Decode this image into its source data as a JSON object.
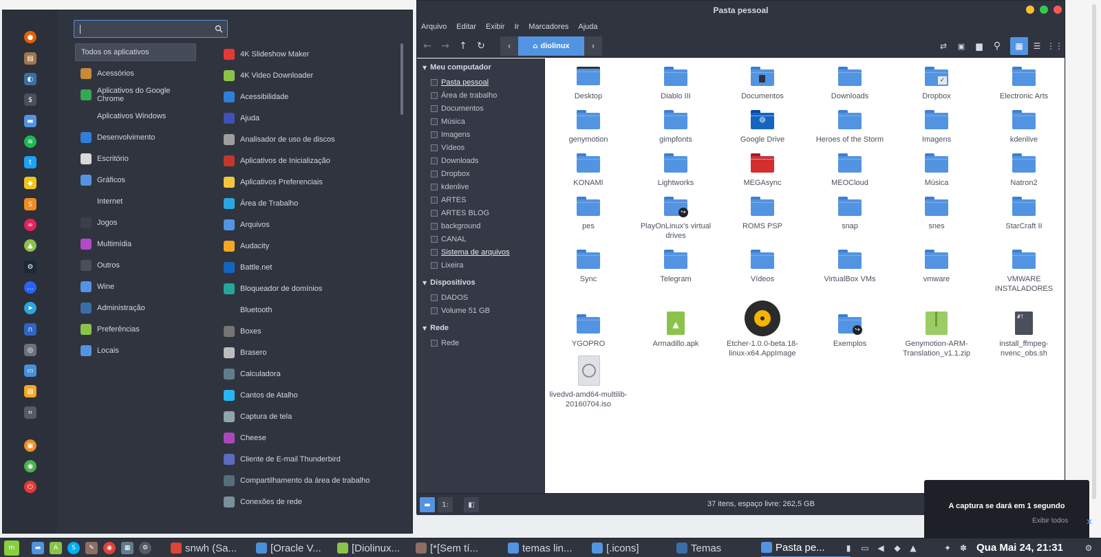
{
  "menu": {
    "search": {
      "value": "",
      "placeholder": ""
    },
    "favorites": [
      {
        "icon": "firefox-icon",
        "color": "#e66000"
      },
      {
        "icon": "archive-icon",
        "color": "#a0774a"
      },
      {
        "icon": "toggle-icon",
        "color": "#3a6ea5"
      },
      {
        "icon": "terminal-icon",
        "color": "#4a4f5a"
      },
      {
        "icon": "folder-icon",
        "color": "#5294e2"
      },
      {
        "icon": "spotify-icon",
        "color": "#1db954"
      },
      {
        "icon": "twitter-icon",
        "color": "#1da1f2"
      },
      {
        "icon": "ideas-icon",
        "color": "#f0c419"
      },
      {
        "icon": "sublime-icon",
        "color": "#f08b22"
      },
      {
        "icon": "flickr-icon",
        "color": "#e0245e"
      },
      {
        "icon": "android-icon",
        "color": "#8bc34a"
      },
      {
        "icon": "steam-icon",
        "color": "#1b2838"
      },
      {
        "icon": "chat-icon",
        "color": "#2962ff"
      },
      {
        "icon": "telegram-icon",
        "color": "#2ca5e0"
      },
      {
        "icon": "audacity-icon",
        "color": "#2e66c4"
      },
      {
        "icon": "gamepad-icon",
        "color": "#6b7280"
      },
      {
        "icon": "monitor-icon",
        "color": "#4a90d9"
      },
      {
        "icon": "photo-icon",
        "color": "#f5a623"
      },
      {
        "icon": "screenshot-icon",
        "color": "#555b66"
      },
      {
        "icon": "lock-icon",
        "color": "#f08b22"
      },
      {
        "icon": "update-icon",
        "color": "#4caf50"
      },
      {
        "icon": "power-icon",
        "color": "#e53935"
      }
    ],
    "categories": [
      {
        "label": "Todos os aplicativos",
        "icon": "all-apps-icon",
        "color": "transparent",
        "selected": true
      },
      {
        "label": "Acessórios",
        "icon": "accessories-icon",
        "color": "#c78a3a"
      },
      {
        "label": "Aplicativos do Google Chrome",
        "icon": "chrome-icon",
        "color": "#34a853"
      },
      {
        "label": "Aplicativos Windows",
        "icon": "windows-apps-icon",
        "color": "transparent"
      },
      {
        "label": "Desenvolvimento",
        "icon": "development-icon",
        "color": "#2f7fd8"
      },
      {
        "label": "Escritório",
        "icon": "office-icon",
        "color": "#d9d9d9"
      },
      {
        "label": "Gráficos",
        "icon": "graphics-icon",
        "color": "#5294e2"
      },
      {
        "label": "Internet",
        "icon": "internet-icon",
        "color": "transparent"
      },
      {
        "label": "Jogos",
        "icon": "games-icon",
        "color": "#3a3f4a"
      },
      {
        "label": "Multimídia",
        "icon": "multimedia-icon",
        "color": "#b24ac4"
      },
      {
        "label": "Outros",
        "icon": "others-icon",
        "color": "#4a4f5a"
      },
      {
        "label": "Wine",
        "icon": "wine-icon",
        "color": "#5294e2"
      },
      {
        "label": "Administração",
        "icon": "administration-icon",
        "color": "#3a6ea5"
      },
      {
        "label": "Preferências",
        "icon": "preferences-icon",
        "color": "#8bc34a"
      },
      {
        "label": "Locais",
        "icon": "places-icon",
        "color": "#5294e2"
      }
    ],
    "apps": [
      {
        "label": "4K Slideshow Maker",
        "icon": "slideshow-icon",
        "color": "#e53935"
      },
      {
        "label": "4K Video Downloader",
        "icon": "video-downloader-icon",
        "color": "#8bc34a"
      },
      {
        "label": "Acessibilidade",
        "icon": "accessibility-icon",
        "color": "#2f7fd8"
      },
      {
        "label": "Ajuda",
        "icon": "help-icon",
        "color": "#3f51b5"
      },
      {
        "label": "Analisador de uso de discos",
        "icon": "disk-usage-icon",
        "color": "#9e9e9e"
      },
      {
        "label": "Aplicativos de Inicialização",
        "icon": "startup-apps-icon",
        "color": "#c0392b"
      },
      {
        "label": "Aplicativos Preferenciais",
        "icon": "preferred-apps-icon",
        "color": "#f5c542"
      },
      {
        "label": "Área de Trabalho",
        "icon": "desktop-icon",
        "color": "#2ca5e0"
      },
      {
        "label": "Arquivos",
        "icon": "files-icon",
        "color": "#5294e2"
      },
      {
        "label": "Audacity",
        "icon": "audacity-icon",
        "color": "#f5a623"
      },
      {
        "label": "Battle.net",
        "icon": "battlenet-icon",
        "color": "#1565c0"
      },
      {
        "label": "Bloqueador de domínios",
        "icon": "domain-blocker-icon",
        "color": "#26a69a"
      },
      {
        "label": "Bluetooth",
        "icon": "bluetooth-icon",
        "color": "#2f343f"
      },
      {
        "label": "Boxes",
        "icon": "boxes-icon",
        "color": "#757575"
      },
      {
        "label": "Brasero",
        "icon": "brasero-icon",
        "color": "#bdbdbd"
      },
      {
        "label": "Calculadora",
        "icon": "calculator-icon",
        "color": "#607d8b"
      },
      {
        "label": "Cantos de Atalho",
        "icon": "hot-corners-icon",
        "color": "#29b6f6"
      },
      {
        "label": "Captura de tela",
        "icon": "screenshot-icon",
        "color": "#90a4ae"
      },
      {
        "label": "Cheese",
        "icon": "cheese-icon",
        "color": "#ab47bc"
      },
      {
        "label": "Cliente de E-mail Thunderbird",
        "icon": "thunderbird-icon",
        "color": "#5c6bc0"
      },
      {
        "label": "Compartilhamento da área de trabalho",
        "icon": "desktop-sharing-icon",
        "color": "#546e7a"
      },
      {
        "label": "Conexões de rede",
        "icon": "network-connections-icon",
        "color": "#78909c"
      }
    ]
  },
  "filemanager": {
    "title": "Pasta pessoal",
    "menubar": [
      "Arquivo",
      "Editar",
      "Exibir",
      "Ir",
      "Marcadores",
      "Ajuda"
    ],
    "path_current": "diolinux",
    "sidebar": {
      "sections": [
        {
          "title": "Meu computador",
          "items": [
            {
              "label": "Pasta pessoal",
              "underline": true
            },
            {
              "label": "Área de trabalho"
            },
            {
              "label": "Documentos"
            },
            {
              "label": "Música"
            },
            {
              "label": "Imagens"
            },
            {
              "label": "Vídeos"
            },
            {
              "label": "Downloads"
            },
            {
              "label": "Dropbox"
            },
            {
              "label": "kdenlive"
            },
            {
              "label": "ARTES"
            },
            {
              "label": "ARTES BLOG"
            },
            {
              "label": "background"
            },
            {
              "label": "CANAL"
            },
            {
              "label": "Sistema de arquivos",
              "underline": true
            },
            {
              "label": "Lixeira"
            }
          ]
        },
        {
          "title": "Dispositivos",
          "items": [
            {
              "label": "DADOS"
            },
            {
              "label": "Volume 51 GB"
            }
          ]
        },
        {
          "title": "Rede",
          "items": [
            {
              "label": "Rede"
            }
          ]
        }
      ]
    },
    "items": [
      {
        "label": "Desktop",
        "type": "desktop"
      },
      {
        "label": "Diablo III",
        "type": "folder"
      },
      {
        "label": "Documentos",
        "type": "folder-doc"
      },
      {
        "label": "Downloads",
        "type": "folder"
      },
      {
        "label": "Dropbox",
        "type": "folder-check"
      },
      {
        "label": "Electronic Arts",
        "type": "folder"
      },
      {
        "label": "genymotion",
        "type": "folder"
      },
      {
        "label": "gimpfonts",
        "type": "folder"
      },
      {
        "label": "Google Drive",
        "type": "gdrive"
      },
      {
        "label": "Heroes of the Storm",
        "type": "folder"
      },
      {
        "label": "Imagens",
        "type": "folder"
      },
      {
        "label": "kdenlive",
        "type": "folder"
      },
      {
        "label": "KONAMI",
        "type": "folder"
      },
      {
        "label": "Lightworks",
        "type": "folder"
      },
      {
        "label": "MEGAsync",
        "type": "mega"
      },
      {
        "label": "MEOCloud",
        "type": "folder"
      },
      {
        "label": "Música",
        "type": "folder"
      },
      {
        "label": "Natron2",
        "type": "folder"
      },
      {
        "label": "pes",
        "type": "folder"
      },
      {
        "label": "PlayOnLinux's virtual drives",
        "type": "folder-link"
      },
      {
        "label": "ROMS PSP",
        "type": "folder"
      },
      {
        "label": "snap",
        "type": "folder"
      },
      {
        "label": "snes",
        "type": "folder"
      },
      {
        "label": "StarCraft II",
        "type": "folder"
      },
      {
        "label": "Sync",
        "type": "folder"
      },
      {
        "label": "Telegram",
        "type": "folder"
      },
      {
        "label": "Vídeos",
        "type": "folder"
      },
      {
        "label": "VirtualBox VMs",
        "type": "folder"
      },
      {
        "label": "vmware",
        "type": "folder"
      },
      {
        "label": "VMWARE INSTALADORES",
        "type": "folder"
      },
      {
        "label": "YGOPRO",
        "type": "folder"
      },
      {
        "label": "Armadillo.apk",
        "type": "apk"
      },
      {
        "label": "Etcher-1.0.0-beta.18-linux-x64.AppImage",
        "type": "appimage"
      },
      {
        "label": "Exemplos",
        "type": "folder-link"
      },
      {
        "label": "Genymotion-ARM-Translation_v1.1.zip",
        "type": "zip"
      },
      {
        "label": "install_ffmpeg-nvenc_obs.sh",
        "type": "script"
      },
      {
        "label": "livedvd-amd64-multilib-20160704.iso",
        "type": "iso"
      }
    ],
    "status": "37 itens, espaço livre: 262,5 GB"
  },
  "notification": {
    "text": "A captura se dará em 1 segundo",
    "button": "Exibir todos"
  },
  "taskbar": {
    "launchers": [
      {
        "icon": "mint-menu-icon",
        "color": "#87cf3e"
      },
      {
        "icon": "files-icon",
        "color": "#5294e2"
      },
      {
        "icon": "android-studio-icon",
        "color": "#8bc34a"
      },
      {
        "icon": "skype-icon",
        "color": "#00aff0"
      },
      {
        "icon": "gimp-icon",
        "color": "#8d6e63"
      },
      {
        "icon": "chrome-icon",
        "color": "#db4437"
      },
      {
        "icon": "video-editor-icon",
        "color": "#607d8b"
      },
      {
        "icon": "steam-icon",
        "color": "#555b66"
      }
    ],
    "tasks": [
      {
        "label": "snwh (Sa...",
        "icon": "chrome-icon",
        "color": "#db4437"
      },
      {
        "label": "[Oracle V...",
        "icon": "monitor-icon",
        "color": "#4a90d9"
      },
      {
        "label": "[Diolinux...",
        "icon": "android-icon",
        "color": "#8bc34a"
      },
      {
        "label": "[*[Sem tí...",
        "icon": "gimp-icon",
        "color": "#8d6e63"
      },
      {
        "label": "temas lin...",
        "icon": "folder-icon",
        "color": "#5294e2"
      },
      {
        "label": "[.icons]",
        "icon": "folder-icon",
        "color": "#5294e2"
      },
      {
        "label": "Temas",
        "icon": "toggle-icon",
        "color": "#3a6ea5"
      },
      {
        "label": "Pasta pe...",
        "icon": "folder-icon",
        "color": "#5294e2",
        "active": true
      }
    ],
    "clock": "Qua Mai 24, 21:31"
  }
}
